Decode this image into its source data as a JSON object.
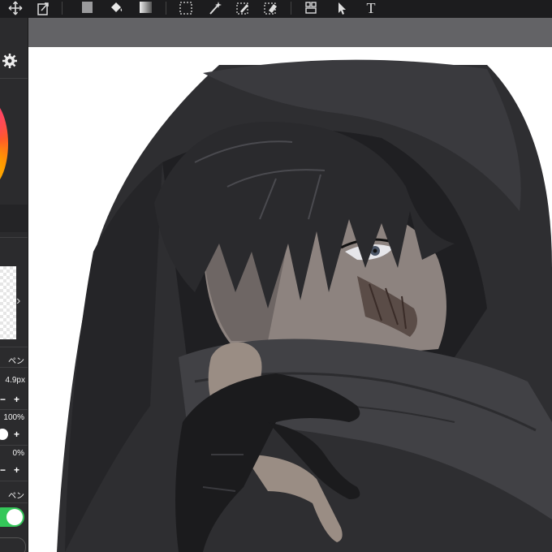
{
  "toolbar": {
    "tools": [
      {
        "name": "move-tool-icon"
      },
      {
        "name": "transform-tool-icon"
      },
      {
        "name": "fill-color-icon"
      },
      {
        "name": "bucket-fill-icon"
      },
      {
        "name": "gradient-icon"
      },
      {
        "name": "select-rect-icon"
      },
      {
        "name": "magic-wand-icon"
      },
      {
        "name": "select-pen-icon"
      },
      {
        "name": "select-eraser-icon"
      },
      {
        "name": "divide-frame-icon"
      },
      {
        "name": "operation-tool-icon"
      },
      {
        "name": "text-tool-icon"
      }
    ],
    "text_tool_glyph": "T"
  },
  "left_panel": {
    "pen_label_1": "ペン",
    "brush_size": "4.9px",
    "opacity_value": "100%",
    "blur_value": "0%",
    "pen_label_2": "ペン",
    "minus": "−",
    "plus": "+",
    "chevron": "›"
  },
  "colors": {
    "toolbar_bg": "#1c1c1e",
    "panel_bg": "#2b2b2d",
    "canvas_bg": "#636366",
    "paper": "#ffffff",
    "toggle_on": "#34c759"
  }
}
